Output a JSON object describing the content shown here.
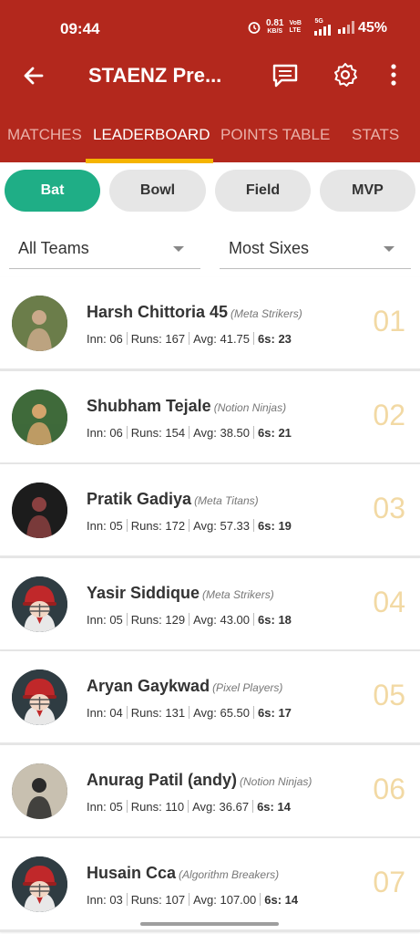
{
  "status_bar": {
    "time": "09:44",
    "net_speed": "0.81",
    "net_unit": "KB/S",
    "volte": "VoB LTE",
    "net_type": "5G",
    "battery": "45%"
  },
  "app_bar": {
    "title": "STAENZ Pre..."
  },
  "tabs": [
    {
      "label": "MATCHES",
      "active": false
    },
    {
      "label": "LEADERBOARD",
      "active": true
    },
    {
      "label": "POINTS TABLE",
      "active": false
    },
    {
      "label": "STATS",
      "active": false
    }
  ],
  "chips": [
    {
      "label": "Bat",
      "active": true
    },
    {
      "label": "Bowl",
      "active": false
    },
    {
      "label": "Field",
      "active": false
    },
    {
      "label": "MVP",
      "active": false
    }
  ],
  "filters": {
    "team": "All Teams",
    "sort": "Most Sixes"
  },
  "stat_labels": {
    "inn": "Inn:",
    "runs": "Runs:",
    "avg": "Avg:",
    "sixes": "6s:"
  },
  "players": [
    {
      "rank": "01",
      "name": "Harsh Chittoria 45",
      "team": "(Meta Strikers)",
      "inn": "06",
      "runs": "167",
      "avg": "41.75",
      "sixes": "23",
      "avatar": "photo"
    },
    {
      "rank": "02",
      "name": "Shubham Tejale",
      "team": "(Notion Ninjas)",
      "inn": "06",
      "runs": "154",
      "avg": "38.50",
      "sixes": "21",
      "avatar": "photo"
    },
    {
      "rank": "03",
      "name": "Pratik Gadiya",
      "team": "(Meta Titans)",
      "inn": "05",
      "runs": "172",
      "avg": "57.33",
      "sixes": "19",
      "avatar": "photo"
    },
    {
      "rank": "04",
      "name": "Yasir Siddique",
      "team": "(Meta Strikers)",
      "inn": "05",
      "runs": "129",
      "avg": "43.00",
      "sixes": "18",
      "avatar": "helmet"
    },
    {
      "rank": "05",
      "name": "Aryan Gaykwad",
      "team": "(Pixel Players)",
      "inn": "04",
      "runs": "131",
      "avg": "65.50",
      "sixes": "17",
      "avatar": "helmet"
    },
    {
      "rank": "06",
      "name": "Anurag Patil (andy)",
      "team": "(Notion Ninjas)",
      "inn": "05",
      "runs": "110",
      "avg": "36.67",
      "sixes": "14",
      "avatar": "photo"
    },
    {
      "rank": "07",
      "name": "Husain Cca",
      "team": "(Algorithm Breakers)",
      "inn": "03",
      "runs": "107",
      "avg": "107.00",
      "sixes": "14",
      "avatar": "helmet"
    }
  ]
}
